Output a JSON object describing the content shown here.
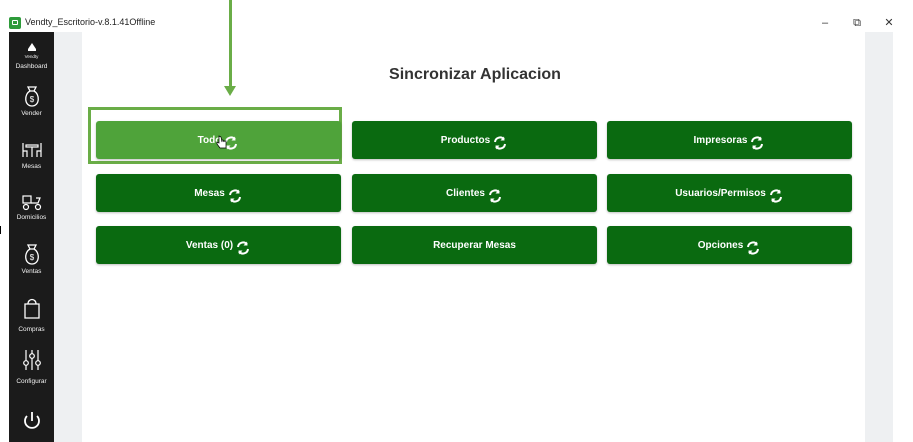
{
  "window": {
    "title": "Vendty_Escritorio-v.8.1.41Offline",
    "minimize": "–",
    "maximize": "⧉",
    "close": "✕"
  },
  "sidebar": {
    "items": [
      {
        "label": "Dashboard",
        "icon": "vendty-logo-icon"
      },
      {
        "label": "Vender",
        "icon": "money-bag-icon"
      },
      {
        "label": "Mesas",
        "icon": "table-chairs-icon"
      },
      {
        "label": "Domicilios",
        "icon": "delivery-scooter-icon"
      },
      {
        "label": "Ventas",
        "icon": "money-bag-icon"
      },
      {
        "label": "Compras",
        "icon": "shopping-bag-icon"
      },
      {
        "label": "Configurar",
        "icon": "sliders-icon"
      },
      {
        "label": "",
        "icon": "power-icon"
      }
    ],
    "logo_text": "Vendty"
  },
  "main": {
    "title": "Sincronizar Aplicacion",
    "buttons": [
      {
        "label": "Todo",
        "icon": "sync-icon",
        "active": true
      },
      {
        "label": "Productos",
        "icon": "sync-icon"
      },
      {
        "label": "Impresoras",
        "icon": "sync-icon"
      },
      {
        "label": "Mesas",
        "icon": "sync-icon"
      },
      {
        "label": "Clientes",
        "icon": "sync-icon"
      },
      {
        "label": "Usuarios/Permisos",
        "icon": "sync-icon"
      },
      {
        "label": "Ventas (0)",
        "icon": "sync-icon"
      },
      {
        "label": "Recuperar Mesas"
      },
      {
        "label": "Opciones",
        "icon": "sync-icon"
      }
    ]
  },
  "colors": {
    "button": "#0a6a10",
    "button_active": "#4fa33a",
    "annotation": "#6aad47",
    "sidebar": "#1b1b1b"
  }
}
